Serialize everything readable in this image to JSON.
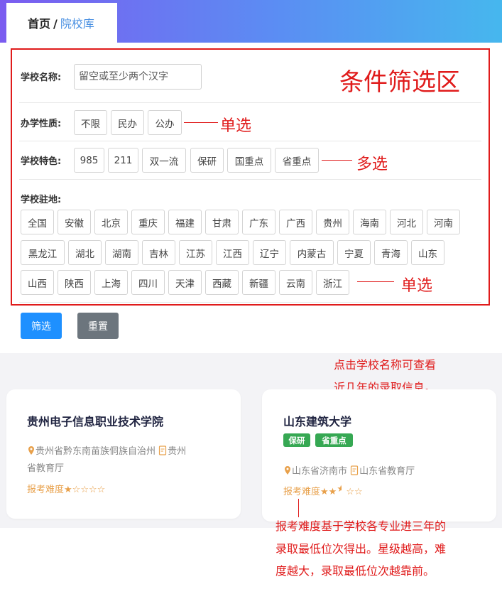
{
  "breadcrumb": {
    "home": "首页",
    "separator": "/",
    "current": "院校库"
  },
  "filters": {
    "name_label": "学校名称:",
    "name_placeholder": "留空或至少两个汉字",
    "nature_label": "办学性质:",
    "nature_options": [
      "不限",
      "民办",
      "公办"
    ],
    "feature_label": "学校特色:",
    "feature_options": [
      "985",
      "211",
      "双一流",
      "保研",
      "国重点",
      "省重点"
    ],
    "location_label": "学校驻地:",
    "location_rows": [
      [
        "全国",
        "安徽",
        "北京",
        "重庆",
        "福建",
        "甘肃",
        "广东",
        "广西",
        "贵州",
        "海南",
        "河北",
        "河南"
      ],
      [
        "黑龙江",
        "湖北",
        "湖南",
        "吉林",
        "江苏",
        "江西",
        "辽宁",
        "内蒙古",
        "宁夏",
        "青海",
        "山东"
      ],
      [
        "山西",
        "陕西",
        "上海",
        "四川",
        "天津",
        "西藏",
        "新疆",
        "云南",
        "浙江"
      ]
    ]
  },
  "buttons": {
    "filter": "筛选",
    "reset": "重置"
  },
  "annotations": {
    "filter_area": "条件筛选区",
    "single_select_1": "单选",
    "multi_select": "多选",
    "single_select_2": "单选",
    "click_hint_1": "点击学校名称可查看",
    "click_hint_2": "近几年的录取信息。",
    "difficulty_note_1": "报考难度基于学校各专业进三年的",
    "difficulty_note_2": "录取最低位次得出。星级越高，难",
    "difficulty_note_3": "度越大，录取最低位次越靠前。"
  },
  "schools": [
    {
      "name": "贵州电子信息职业技术学院",
      "tags": [],
      "location": "贵州省黔东南苗族侗族自治州",
      "authority_line1": "贵州",
      "authority_line2": "省教育厅",
      "difficulty_label": "报考难度",
      "difficulty_stars": 1
    },
    {
      "name": "山东建筑大学",
      "tags": [
        "保研",
        "省重点"
      ],
      "location": "山东省济南市",
      "authority": "山东省教育厅",
      "difficulty_label": "报考难度",
      "difficulty_stars": 2.5
    }
  ],
  "colors": {
    "accent": "#1e90ff",
    "reset": "#6c757d",
    "tag": "#36a853",
    "difficulty": "#e8a04a",
    "annotation": "#e01b1b"
  }
}
